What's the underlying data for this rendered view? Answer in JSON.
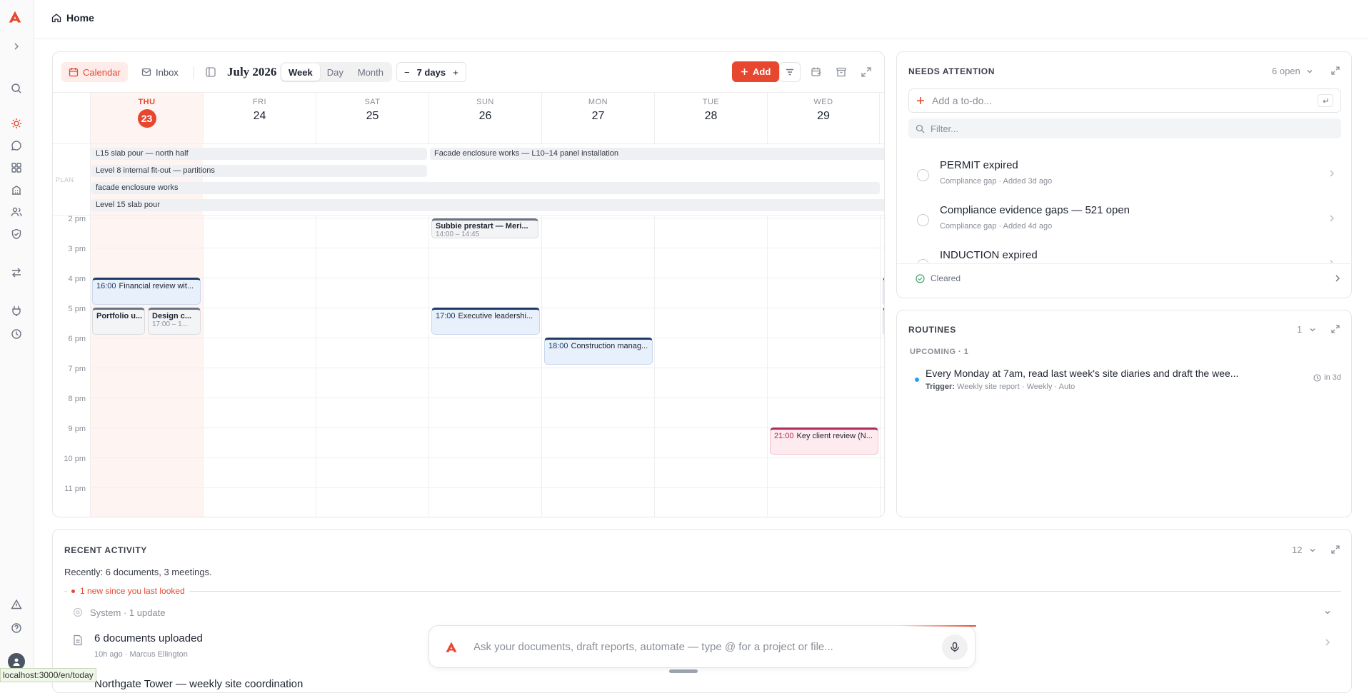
{
  "breadcrumb": {
    "title": "Home"
  },
  "calendar": {
    "tabs": [
      {
        "label": "Calendar",
        "active": true
      },
      {
        "label": "Inbox",
        "active": false
      }
    ],
    "month_label": "July 2026",
    "views": [
      {
        "label": "Week",
        "active": true
      },
      {
        "label": "Day",
        "active": false
      },
      {
        "label": "Month",
        "active": false
      }
    ],
    "range": {
      "minus": "−",
      "label": "7 days",
      "plus": "+"
    },
    "add_label": "Add",
    "days": [
      {
        "name": "THU",
        "num": "23",
        "today": true
      },
      {
        "name": "FRI",
        "num": "24"
      },
      {
        "name": "SAT",
        "num": "25"
      },
      {
        "name": "SUN",
        "num": "26"
      },
      {
        "name": "MON",
        "num": "27"
      },
      {
        "name": "TUE",
        "num": "28"
      },
      {
        "name": "WED",
        "num": "29"
      }
    ],
    "plan_label": "PLAN",
    "plan_bars": [
      {
        "text": "L15 slab pour — north half"
      },
      {
        "text": "Facade enclosure works — L10–14 panel installation"
      },
      {
        "text": "Level 8 internal fit-out — partitions"
      },
      {
        "text": "facade enclosure works"
      },
      {
        "text": "Level 15 slab pour"
      }
    ],
    "hours": [
      "2 pm",
      "3 pm",
      "4 pm",
      "5 pm",
      "6 pm",
      "7 pm",
      "8 pm",
      "9 pm",
      "10 pm",
      "11 pm"
    ],
    "events": [
      {
        "time": "",
        "title": "Subbie prestart — Meri...",
        "sub": "14:00 – 14:45"
      },
      {
        "time": "16:00",
        "title": "Financial review wit..."
      },
      {
        "time": "",
        "title": "Portfolio u..."
      },
      {
        "time": "",
        "title": "Design c...",
        "sub": "17:00 – 1..."
      },
      {
        "time": "17:00",
        "title": "Executive leadershi..."
      },
      {
        "time": "18:00",
        "title": "Construction manag..."
      },
      {
        "time": "21:00",
        "title": "Key client review (N..."
      }
    ]
  },
  "needs_attention": {
    "title": "NEEDS ATTENTION",
    "count": "6 open",
    "add_placeholder": "Add a to-do...",
    "filter_placeholder": "Filter...",
    "items": [
      {
        "title": "PERMIT expired",
        "category": "Compliance gap",
        "added": "Added 3d ago"
      },
      {
        "title": "Compliance evidence gaps — 521 open",
        "category": "Compliance gap",
        "added": "Added 4d ago"
      },
      {
        "title": "INDUCTION expired",
        "category": "",
        "added": ""
      }
    ],
    "cleared_label": "Cleared"
  },
  "routines": {
    "title": "ROUTINES",
    "count": "1",
    "upcoming_label": "UPCOMING · 1",
    "items": [
      {
        "title": "Every Monday at 7am, read last week's site diaries and draft the wee...",
        "trigger_label": "Trigger:",
        "trigger": "Weekly site report · Weekly · Auto",
        "due": "in 3d"
      }
    ]
  },
  "recent": {
    "title": "RECENT ACTIVITY",
    "count": "12",
    "summary": "Recently: 6 documents, 3 meetings.",
    "new_since": "1 new since you last looked",
    "system_row": "System · 1 update",
    "items": [
      {
        "title": "6 documents uploaded",
        "time": "10h ago",
        "user": "Marcus Ellington"
      },
      {
        "title": "Northgate Tower — weekly site coordination",
        "time": "",
        "user": ""
      }
    ]
  },
  "chat": {
    "placeholder": "Ask your documents, draft reports, automate — type @ for a project or file..."
  },
  "status_url": "localhost:3000/en/today",
  "colors": {
    "accent": "#e8472f",
    "event_blue": "#1e3a66",
    "event_pink": "#b22a55"
  }
}
